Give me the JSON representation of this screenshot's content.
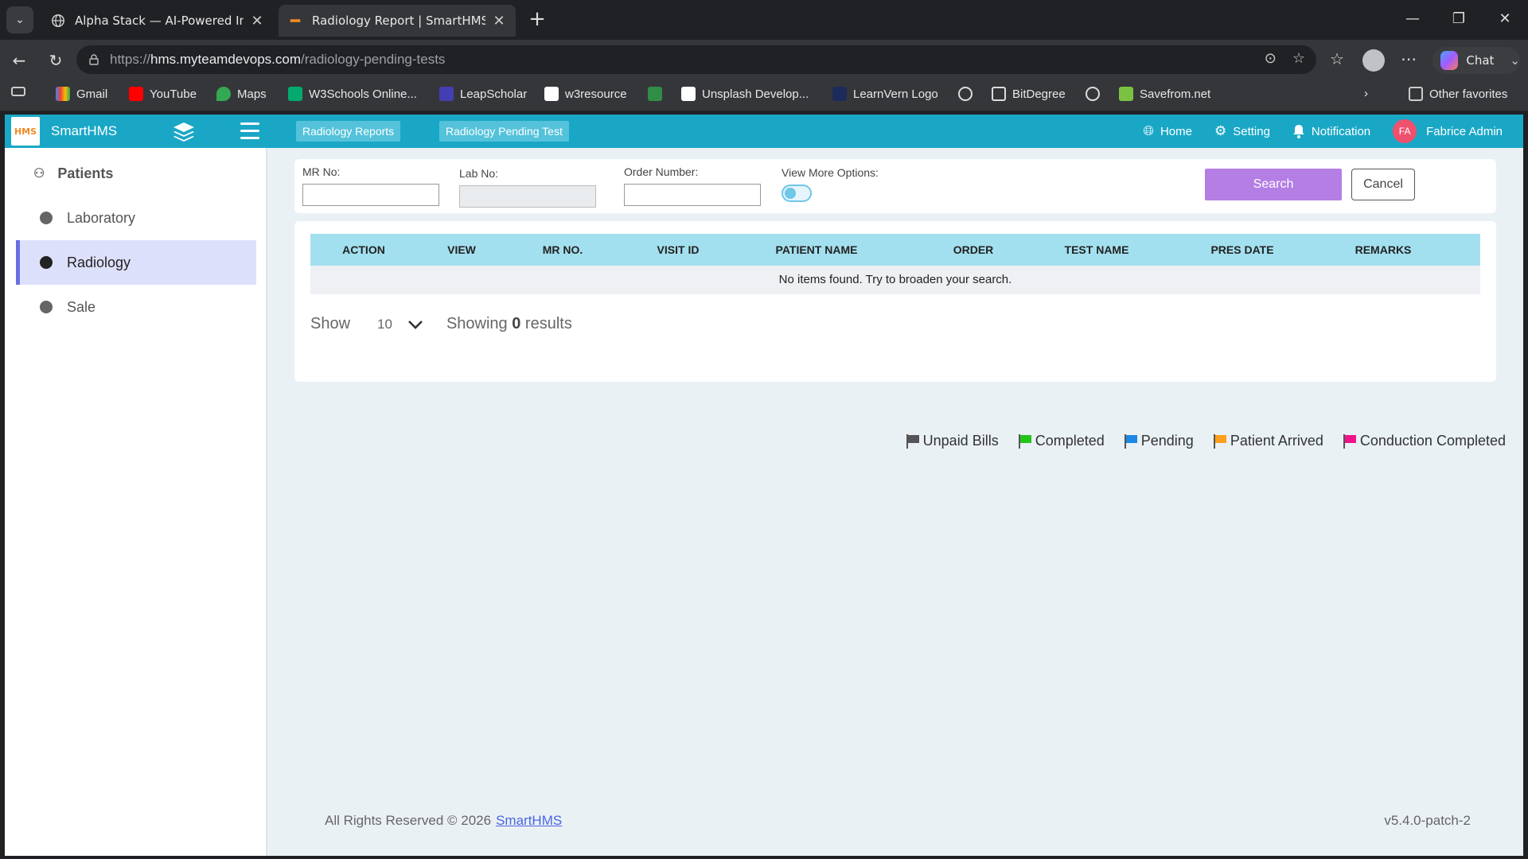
{
  "browser": {
    "tabs": [
      {
        "title": "Alpha Stack — AI-Powered Investi",
        "close": "✕"
      },
      {
        "title": "Radiology Report | SmartHMS",
        "close": "✕"
      }
    ],
    "url_prefix": "https://",
    "url_host": "hms.myteamdevops.com",
    "url_path": "/radiology-pending-tests",
    "chat_label": "Chat",
    "bookmarks": [
      "Gmail",
      "YouTube",
      "Maps",
      "W3Schools Online...",
      "LeapScholar",
      "w3resource",
      "Unsplash Develop...",
      "LearnVern Logo",
      "BitDegree",
      "Savefrom.net"
    ],
    "other_favorites": "Other favorites"
  },
  "app": {
    "brand_logo": "HMS",
    "brand_name": "SmartHMS",
    "top_tabs": [
      "Radiology Reports",
      "Radiology Pending Test"
    ],
    "nav": {
      "home": "Home",
      "setting": "Setting",
      "notification": "Notification",
      "avatar_initials": "FA",
      "user": "Fabrice Admin"
    },
    "sidebar": {
      "patients": "Patients",
      "items": [
        {
          "label": "Laboratory"
        },
        {
          "label": "Radiology"
        },
        {
          "label": "Sale"
        }
      ]
    },
    "filters": {
      "mr_no_label": "MR No:",
      "lab_no_label": "Lab No:",
      "order_number_label": "Order Number:",
      "view_more_label": "View More Options:",
      "search_label": "Search",
      "cancel_label": "Cancel"
    },
    "table": {
      "columns": [
        "ACTION",
        "VIEW",
        "MR NO.",
        "VISIT ID",
        "PATIENT NAME",
        "ORDER",
        "TEST NAME",
        "PRES DATE",
        "REMARKS"
      ],
      "empty_message": "No items found. Try to broaden your search."
    },
    "pager": {
      "show_label": "Show",
      "page_size": "10",
      "showing_prefix": "Showing",
      "count": "0",
      "results_suffix": "results"
    },
    "legend": [
      {
        "label": "Unpaid Bills",
        "color": "#555555"
      },
      {
        "label": "Completed",
        "color": "#22c41a"
      },
      {
        "label": "Pending",
        "color": "#1e88e5"
      },
      {
        "label": "Patient Arrived",
        "color": "#ff9f1a"
      },
      {
        "label": "Conduction Completed",
        "color": "#f0148c"
      }
    ],
    "footer": {
      "text": "All Rights Reserved © 2026",
      "link": "SmartHMS",
      "version": "v5.4.0-patch-2"
    }
  }
}
